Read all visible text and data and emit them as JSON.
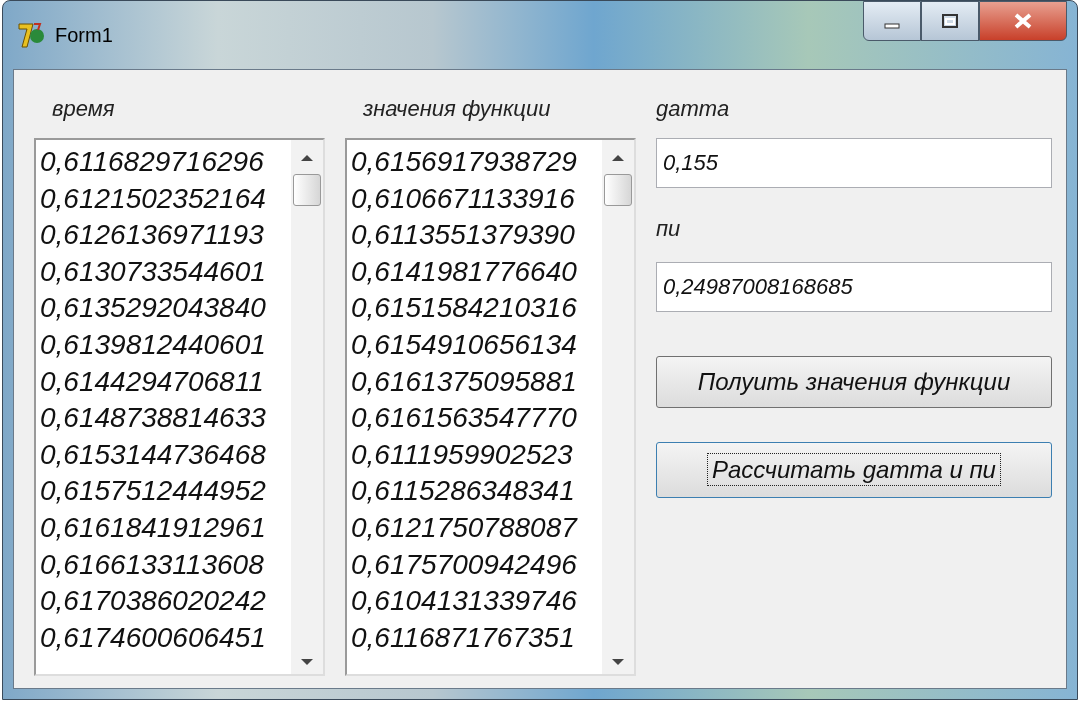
{
  "window": {
    "title": "Form1"
  },
  "lists": [
    {
      "label": "время",
      "items": [
        "0,6116829716296",
        "0,6121502352164",
        "0,6126136971193",
        "0,6130733544601",
        "0,6135292043840",
        "0,6139812440601",
        "0,6144294706811",
        "0,6148738814633",
        "0,6153144736468",
        "0,6157512444952",
        "0,6161841912961",
        "0,6166133113608",
        "0,6170386020242",
        "0,6174600606451"
      ]
    },
    {
      "label": "значения функции",
      "items": [
        "0,6156917938729",
        "0,6106671133916",
        "0,6113551379390",
        "0,6141981776640",
        "0,6151584210316",
        "0,6154910656134",
        "0,6161375095881",
        "0,6161563547770",
        "0,6111959902523",
        "0,6115286348341",
        "0,6121750788087",
        "0,6175700942496",
        "0,6104131339746",
        "0,6116871767351"
      ]
    }
  ],
  "fields": [
    {
      "label": "gamma",
      "value": "0,155"
    },
    {
      "label": "пи",
      "value": "0,24987008168685"
    }
  ],
  "buttons": [
    {
      "label": "Полуить значения функции",
      "focused": false
    },
    {
      "label": "Рассчитать gamma и пи",
      "focused": true
    }
  ]
}
